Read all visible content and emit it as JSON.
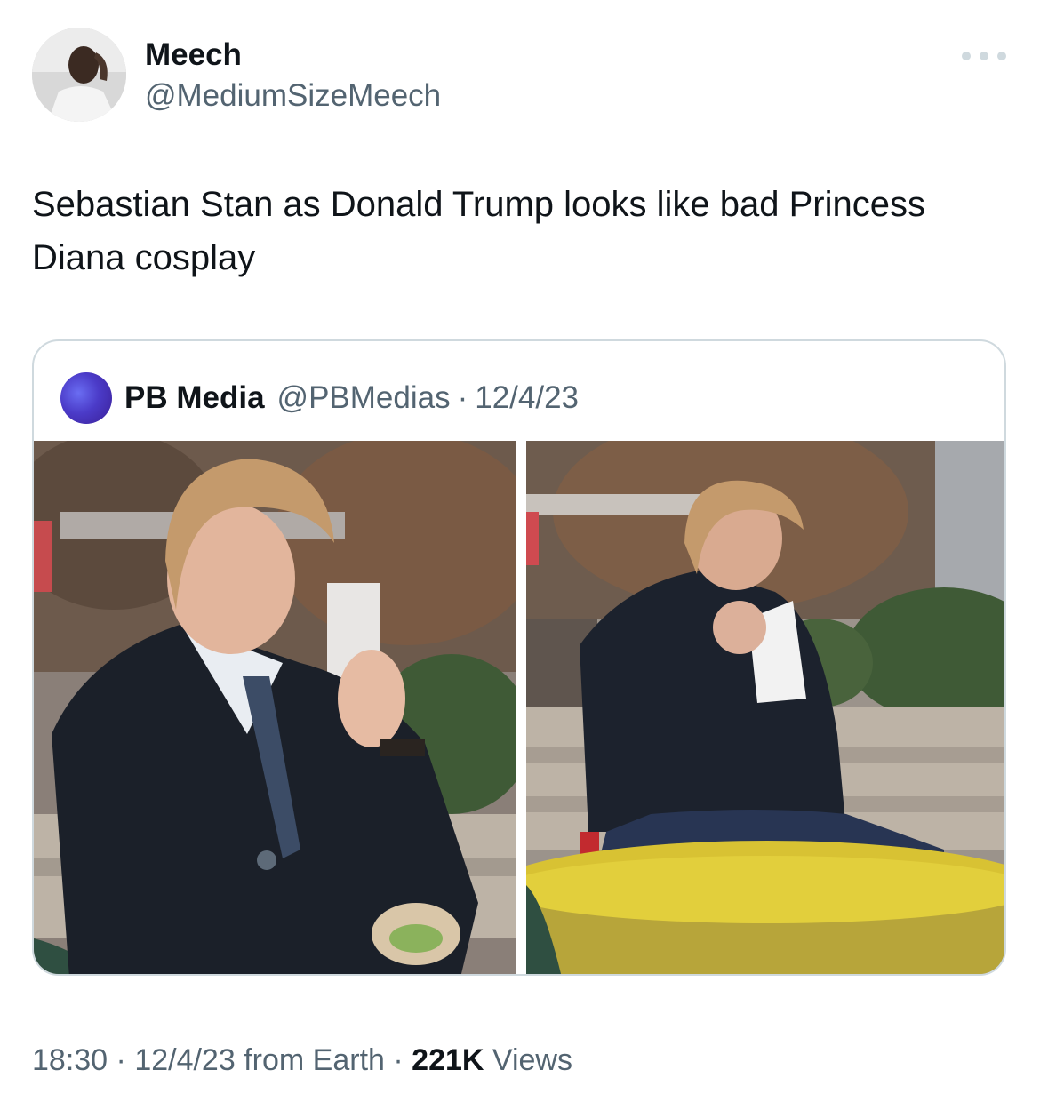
{
  "tweet": {
    "author_name": "Meech",
    "author_handle": "@MediumSizeMeech",
    "text": "Sebastian Stan as Donald Trump looks like bad Princess Diana cosplay"
  },
  "quote": {
    "name": "PB Media",
    "handle": "@PBMedias",
    "separator": "·",
    "date": "12/4/23"
  },
  "footer": {
    "time": "18:30",
    "sep1": " · ",
    "date": "12/4/23",
    "source": " from Earth",
    "sep2": " · ",
    "views_count": "221K",
    "views_label": " Views"
  },
  "colors": {
    "text_primary": "#0f1419",
    "text_secondary": "#536471",
    "border": "#cfd9de",
    "more_dots": "#cfd9de"
  },
  "icons": [
    "more-icon"
  ]
}
